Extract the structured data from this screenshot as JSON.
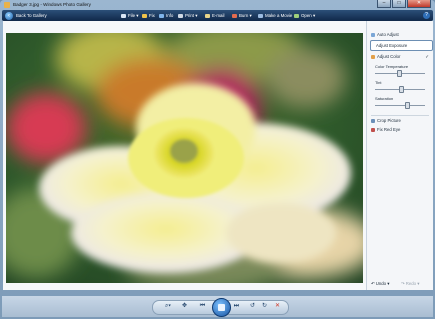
{
  "window": {
    "title": "Badger 3.jpg - Windows Photo Gallery",
    "caption_minimize": "–",
    "caption_maximize": "□",
    "caption_close": "✕"
  },
  "toolbar": {
    "back_label": "Back To Gallery",
    "menu": [
      {
        "label": "File ▾",
        "icon": "file-icon",
        "color": "#d9e6f5"
      },
      {
        "label": "Fix",
        "icon": "fix-icon",
        "color": "#f0c34a"
      },
      {
        "label": "Info",
        "icon": "info-icon",
        "color": "#7fb4ea"
      },
      {
        "label": "Print ▾",
        "icon": "print-icon",
        "color": "#cfd8e3"
      },
      {
        "label": "E-mail",
        "icon": "email-icon",
        "color": "#e8d58a"
      },
      {
        "label": "Burn ▾",
        "icon": "burn-icon",
        "color": "#e26b4f"
      },
      {
        "label": "Make a Movie",
        "icon": "movie-icon",
        "color": "#9bbbe0"
      },
      {
        "label": "Open ▾",
        "icon": "open-icon",
        "color": "#9fd07a"
      }
    ],
    "help": "?"
  },
  "panel": {
    "auto_adjust": "Auto Adjust",
    "adjust_exposure": "Adjust Exposure",
    "adjust_color": "Adjust Color",
    "check_mark": "✓",
    "color_temperature": "Color Temperature",
    "tint": "Tint",
    "saturation": "Saturation",
    "sliders": {
      "color_temperature": 0.45,
      "tint": 0.5,
      "saturation": 0.62
    },
    "crop_picture": "Crop Picture",
    "fix_red_eye": "Fix Red Eye",
    "undo": "Undo ▾",
    "redo": "Redo ▾"
  },
  "bottombar": {
    "zoom": "⌕▾",
    "fit": "✥",
    "prev": "⏮",
    "next": "⏭",
    "rotate_ccw": "↺",
    "rotate_cw": "↻",
    "delete": "✕"
  }
}
